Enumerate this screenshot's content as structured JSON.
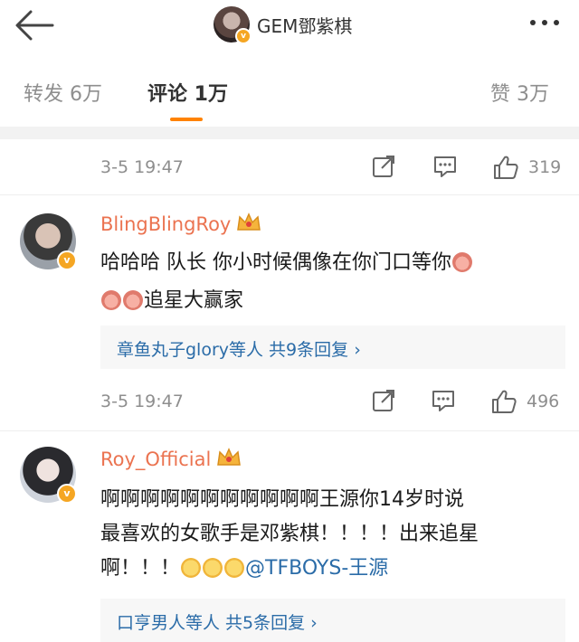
{
  "header": {
    "title": "GEM鄧紫棋",
    "back_icon": "back-arrow-icon",
    "more_icon": "more-dots-icon"
  },
  "tabs": {
    "repost": "转发 6万",
    "comments": "评论 1万",
    "likes": "赞 3万"
  },
  "colors": {
    "accent": "#ff8200",
    "username": "#eb7350",
    "link": "#2b6ca8",
    "muted": "#8e8e8e"
  },
  "top_meta": {
    "time": "3-5 19:47",
    "likes": "319"
  },
  "comments": [
    {
      "username": "BlingBlingRoy",
      "line1": "哈哈哈 队长 你小时候偶像在你门口等你",
      "line2": "追星大赢家",
      "reply": "章鱼丸子glory等人  共9条回复 ›",
      "time": "3-5 19:47",
      "likes": "496"
    },
    {
      "username": "Roy_Official",
      "line1": "啊啊啊啊啊啊啊啊啊啊啊王源你14岁时说",
      "line2": "最喜欢的女歌手是邓紫棋！！！！出来追星",
      "line3": "啊！！！",
      "mention": "@TFBOYS-王源",
      "reply": "口亨男人等人  共5条回复 ›"
    }
  ]
}
